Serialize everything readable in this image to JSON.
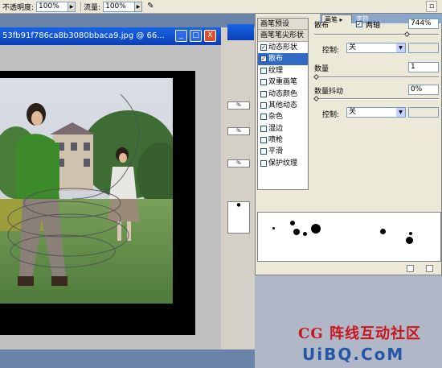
{
  "options_bar": {
    "opacity_label": "不透明度:",
    "opacity_value": "100%",
    "flow_label": "流量:",
    "flow_value": "100%"
  },
  "document": {
    "title": "53fb91f786ca8b3080bbaca9.jpg @ 66...",
    "minimize": "_",
    "maximize": "□",
    "close": "X"
  },
  "palette_tabs": {
    "brush": "画笔",
    "character": "字符"
  },
  "brush_list": [
    {
      "label": "画笔预设",
      "header": true
    },
    {
      "label": "画笔笔尖形状",
      "header": true
    },
    {
      "label": "动态形状",
      "checked": true
    },
    {
      "label": "散布",
      "checked": true,
      "selected": true
    },
    {
      "label": "纹理",
      "checked": false
    },
    {
      "label": "双重画笔",
      "checked": false
    },
    {
      "label": "动态颜色",
      "checked": false
    },
    {
      "label": "其他动态",
      "checked": false
    },
    {
      "label": "杂色",
      "checked": false
    },
    {
      "label": "湿边",
      "checked": false
    },
    {
      "label": "喷枪",
      "checked": false
    },
    {
      "label": "平滑",
      "checked": false
    },
    {
      "label": "保护纹理",
      "checked": false
    }
  ],
  "scatter": {
    "scatter_label": "散布",
    "both_axes_label": "两轴",
    "scatter_value": "744%",
    "control_label": "控制:",
    "control_value": "关",
    "count_label": "数量",
    "count_value": "1",
    "count_jitter_label": "数量抖动",
    "count_jitter_value": "0%",
    "control2_label": "控制:",
    "control2_value": "关"
  },
  "watermark": {
    "line1": "CG 阵线互动社区",
    "line2": "UiBQ.CoM"
  }
}
